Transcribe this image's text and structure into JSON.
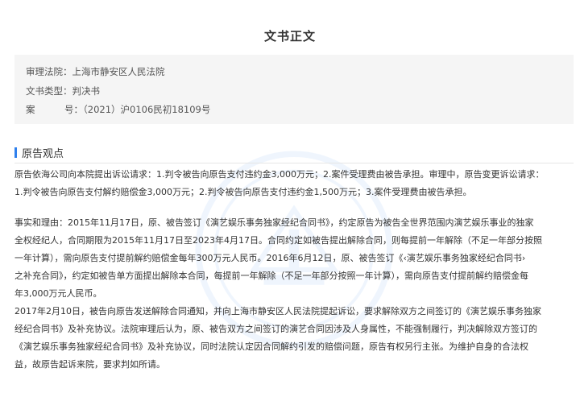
{
  "title": "文书正文",
  "meta": {
    "court_label": "审理法院：",
    "court_value": "上海市静安区人民法院",
    "doctype_label": "文书类型：",
    "doctype_value": "判决书",
    "case_label_a": "案",
    "case_label_b": "号：",
    "case_value": "（2021）沪0106民初18109号"
  },
  "section": {
    "title": "原告观点"
  },
  "paragraphs": {
    "p1": [
      "原告依海公司向本院提出诉讼请求：1.判令被告向原告支付违约金3,000万元；2.案件受理费由被告承担。审理中，原告变更诉讼请求：",
      "1.判令被告向原告支付解约赔偿金3,000万元；2.判令被告向原告支付违约金1,500万元；3.案件受理费由被告承担。"
    ],
    "p2": [
      "事实和理由：2015年11月17日，原、被告签订《演艺娱乐事务独家经纪合同书》，约定原告为被告全世界范围内演艺娱乐事业的独家",
      "全权经纪人，合同期限为2015年11月17日至2023年4月17日。合同约定如被告提出解除合同，则每提前一年解除（不足一年部分按照",
      "一年计算），需向原告支付提前解约赔偿金每年300万元人民币。2016年6月12日，原、被告签订《‹演艺娱乐事务独家经纪合同书›",
      "之补充合同》，约定如被告单方面提出解除本合同，每提前一年解除（不足一年部分按照一年计算），需向原告支付提前解约赔偿金每",
      "年3,000万元人民币。"
    ],
    "p3": [
      "2017年2月10日，被告向原告发送解除合同通知，并向上海市静安区人民法院提起诉讼，要求解除双方之间签订的《演艺娱乐事务独家",
      "经纪合同书》及补充协议。法院审理后认为，原、被告双方之间签订的演艺合同因涉及人身属性，不能强制履行，判决解除双方签订的",
      "《演艺娱乐事务独家经纪合同书》及补充协议，同时法院认定因合同解约引发的赔偿问题，原告有权另行主张。为维护自身的合法权",
      "益，故原告起诉来院，要求判如所请。"
    ]
  },
  "colors": {
    "accent": "#2f80ed",
    "meta_bg": "#f5f5f5",
    "text": "#333333"
  }
}
